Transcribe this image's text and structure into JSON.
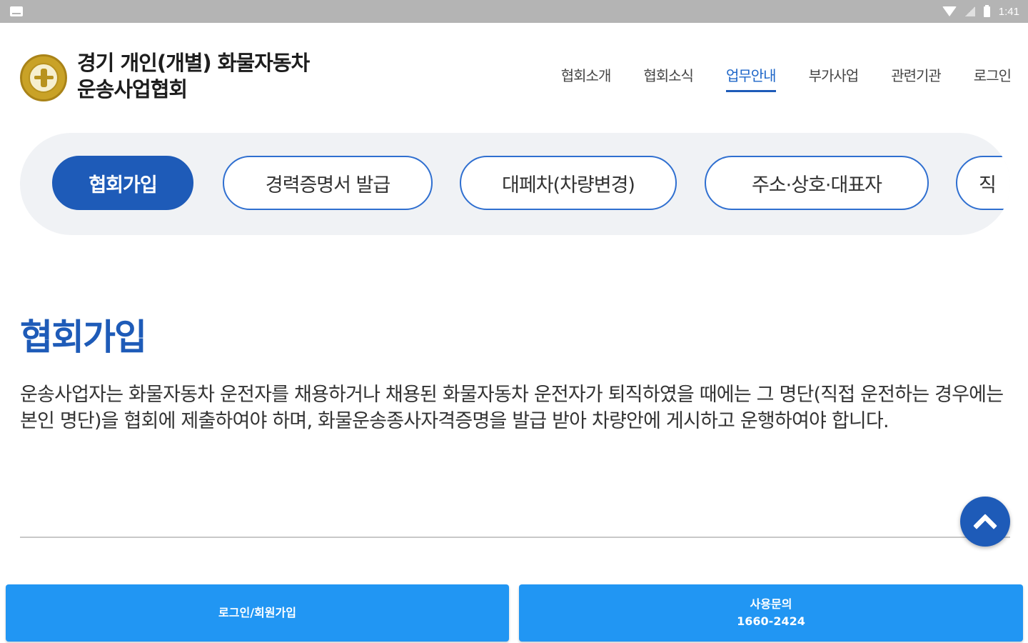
{
  "status_bar": {
    "time": "1:41"
  },
  "header": {
    "org_name_line1": "경기 개인(개별) 화물자동차",
    "org_name_line2": "운송사업협회"
  },
  "nav": {
    "items": [
      {
        "label": "협회소개"
      },
      {
        "label": "협회소식"
      },
      {
        "label": "업무안내",
        "active": true
      },
      {
        "label": "부가사업"
      },
      {
        "label": "관련기관"
      },
      {
        "label": "로그인"
      }
    ]
  },
  "tabs": [
    {
      "label": "협회가입",
      "active": true
    },
    {
      "label": "경력증명서 발급"
    },
    {
      "label": "대페차(차량변경)"
    },
    {
      "label": "주소·상호·대표자"
    },
    {
      "label": "직"
    }
  ],
  "main": {
    "title": "협회가입",
    "description": "운송사업자는 화물자동차 운전자를 채용하거나 채용된 화물자동차 운전자가 퇴직하였을 때에는 그 명단(직접 운전하는 경우에는 본인 명단)을 협회에 제출하여야 하며, 화물운송종사자격증명을 발급 받아 차량안에 게시하고 운행하여야 합니다."
  },
  "bottom": {
    "login_label": "로그인/회원가입",
    "inquiry_label": "사용문의",
    "inquiry_phone": "1660-2424"
  },
  "colors": {
    "primary": "#1e5bb8",
    "bottom_button": "#2196f3",
    "status_bar": "#b4b4b4",
    "tabbar_bg": "#f0f2f5"
  },
  "icons": [
    "gallery-icon",
    "wifi-icon",
    "signal-icon",
    "battery-icon",
    "association-logo-icon",
    "chevron-up-icon"
  ]
}
